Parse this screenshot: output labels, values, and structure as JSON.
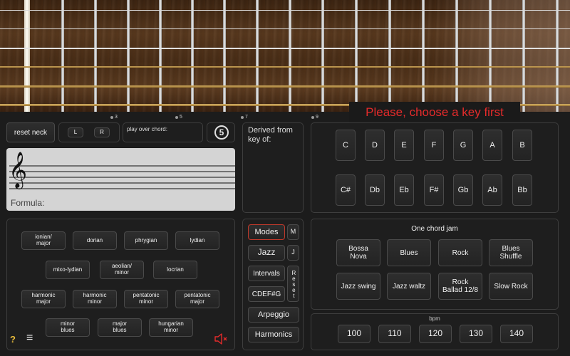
{
  "fret_markers": [
    "3",
    "5",
    "7",
    "9"
  ],
  "message": "Please, choose a key first",
  "neck_controls": {
    "reset_neck": "reset neck",
    "left": "L",
    "right": "R",
    "play_over_chord": "play over chord:",
    "number": "5"
  },
  "staff": {
    "formula_label": "Formula:"
  },
  "derived": {
    "label": "Derived from key of:"
  },
  "keys_row1": [
    "C",
    "D",
    "E",
    "F",
    "G",
    "A",
    "B"
  ],
  "keys_row2": [
    "C#",
    "Db",
    "Eb",
    "F#",
    "Gb",
    "Ab",
    "Bb"
  ],
  "scales": {
    "row1": [
      "ionian/\nmajor",
      "dorian",
      "phrygian",
      "lydian"
    ],
    "row2": [
      "mixo-lydian",
      "aeolian/\nminor",
      "locrian"
    ],
    "row3": [
      "harmonic\nmajor",
      "harmonic\nminor",
      "pentatonic\nminor",
      "pentatonic\nmajor"
    ],
    "row4": [
      "minor\nblues",
      "major\nblues",
      "hungarian\nminor"
    ]
  },
  "categories": {
    "modes": "Modes",
    "modes_short": "M",
    "jazz": "Jazz",
    "jazz_short": "J",
    "intervals": "Intervals",
    "reset": "Reset",
    "cdefg": "CDEF#G",
    "arpeggio": "Arpeggio",
    "harmonics": "Harmonics"
  },
  "jam": {
    "title": "One chord jam",
    "styles_row1": [
      "Bossa\nNova",
      "Blues",
      "Rock",
      "Blues\nShuffle"
    ],
    "styles_row2": [
      "Jazz swing",
      "Jazz waltz",
      "Rock\nBallad 12/8",
      "Slow Rock"
    ]
  },
  "bpm": {
    "label": "bpm",
    "values": [
      "100",
      "110",
      "120",
      "130",
      "140"
    ]
  },
  "bottom": {
    "help": "?",
    "menu": "≡"
  },
  "colors": {
    "accent_red": "#e52b2b",
    "modes_border": "#c0392b",
    "staff_bg": "#d4d4d4"
  },
  "icons": [
    "help-icon",
    "menu-icon",
    "speaker-muted-icon",
    "treble-clef-icon"
  ]
}
